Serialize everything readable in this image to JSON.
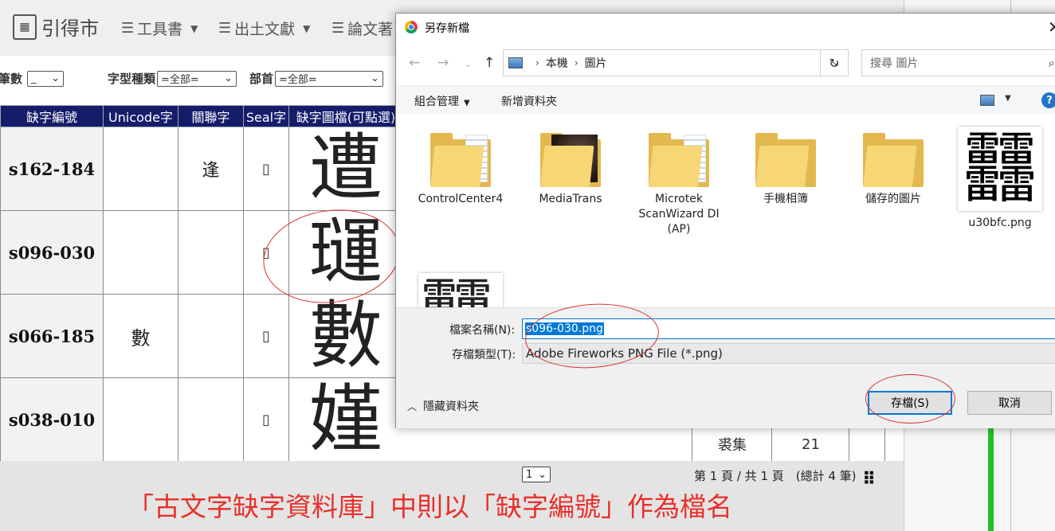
{
  "app": {
    "brand": "引得市",
    "menu": [
      {
        "label": "工具書"
      },
      {
        "label": "出土文獻"
      },
      {
        "label": "論文著"
      }
    ]
  },
  "filters": {
    "strokes_label": "筆數",
    "strokes_value": "_",
    "type_label": "字型種類",
    "type_value": "=全部=",
    "radical_label": "部首",
    "radical_value": "=全部="
  },
  "table": {
    "headers": [
      "缺字編號",
      "Unicode字",
      "關聯字",
      "Seal字",
      "缺字圖檔(可點選)"
    ],
    "rows": [
      {
        "code": "s162-184",
        "unicode": "",
        "related": "逢",
        "seal": "",
        "glyph": "遭"
      },
      {
        "code": "s096-030",
        "unicode": "",
        "related": "",
        "seal": "",
        "glyph": "璭"
      },
      {
        "code": "s066-185",
        "unicode": "數",
        "related": "",
        "seal": "",
        "glyph": "數"
      },
      {
        "code": "s038-010",
        "unicode": "",
        "related": "",
        "seal": "",
        "glyph": "嫤"
      }
    ],
    "partial_cells": [
      "裘集",
      "21"
    ]
  },
  "footer": {
    "page_select": "1",
    "page_info": "第 1 頁 / 共 1 頁　(總計 4 筆)"
  },
  "caption": "「古文字缺字資料庫」中則以「缺字編號」作為檔名",
  "dialog": {
    "title": "另存新檔",
    "breadcrumb": [
      "本機",
      "圖片"
    ],
    "search_placeholder": "搜尋 圖片",
    "organize": "組合管理",
    "new_folder": "新增資料夾",
    "help": "?",
    "files": [
      {
        "name": "ControlCenter4",
        "kind": "folder"
      },
      {
        "name": "MediaTrans",
        "kind": "photo-folder"
      },
      {
        "name": "Microtek ScanWizard DI (AP)",
        "kind": "folder"
      },
      {
        "name": "手機相簿",
        "kind": "empty-folder"
      },
      {
        "name": "儲存的圖片",
        "kind": "empty-folder"
      },
      {
        "name": "u30bfc.png",
        "kind": "image",
        "glyph": "䨻"
      }
    ],
    "partial_thumb_glyph": "䨻",
    "filename_label": "檔案名稱(N):",
    "filename_value": "s096-030.png",
    "filetype_label": "存檔類型(T):",
    "filetype_value": "Adobe Fireworks PNG File (*.png)",
    "hide_folders": "隱藏資料夾",
    "save": "存檔(S)",
    "cancel": "取消"
  },
  "colors": {
    "header_bg": "#151d6b",
    "caption": "#e8302a",
    "accent": "#0078d7",
    "annotation": "#d9322b"
  }
}
